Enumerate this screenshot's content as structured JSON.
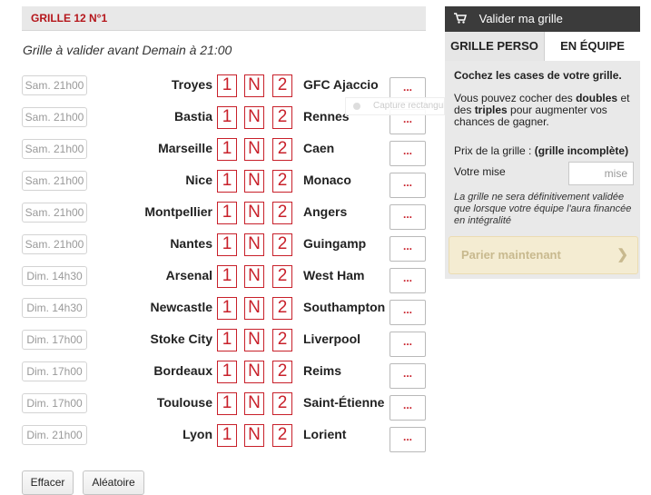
{
  "grid": {
    "title": "GRILLE 12 N°1",
    "deadline": "Grille à valider avant Demain à 21:00",
    "pick_labels": [
      "1",
      "N",
      "2"
    ],
    "more_label": "...",
    "matches": [
      {
        "date": "Sam. 21h00",
        "home": "Troyes",
        "away": "GFC Ajaccio"
      },
      {
        "date": "Sam. 21h00",
        "home": "Bastia",
        "away": "Rennes"
      },
      {
        "date": "Sam. 21h00",
        "home": "Marseille",
        "away": "Caen"
      },
      {
        "date": "Sam. 21h00",
        "home": "Nice",
        "away": "Monaco"
      },
      {
        "date": "Sam. 21h00",
        "home": "Montpellier",
        "away": "Angers"
      },
      {
        "date": "Sam. 21h00",
        "home": "Nantes",
        "away": "Guingamp"
      },
      {
        "date": "Dim. 14h30",
        "home": "Arsenal",
        "away": "West Ham"
      },
      {
        "date": "Dim. 14h30",
        "home": "Newcastle",
        "away": "Southampton"
      },
      {
        "date": "Dim. 17h00",
        "home": "Stoke City",
        "away": "Liverpool"
      },
      {
        "date": "Dim. 17h00",
        "home": "Bordeaux",
        "away": "Reims"
      },
      {
        "date": "Dim. 17h00",
        "home": "Toulouse",
        "away": "Saint-Étienne"
      },
      {
        "date": "Dim. 21h00",
        "home": "Lyon",
        "away": "Lorient"
      }
    ],
    "tooltip_text": "Capture rectangulaire",
    "clear_label": "Effacer",
    "random_label": "Aléatoire"
  },
  "panel": {
    "header": "Valider ma grille",
    "tabs": [
      "GRILLE PERSO",
      "EN ÉQUIPE"
    ],
    "active_tab": "EN ÉQUIPE",
    "instruction": "Cochez les cases de votre grille.",
    "info_1": "Vous pouvez cocher des ",
    "info_doubles": "doubles",
    "info_2": " et des ",
    "info_triples": "triples",
    "info_3": " pour augmenter vos chances de gagner.",
    "price_label": "Prix de la grille :",
    "price_value": "(grille incomplète)",
    "stake_label": "Votre mise",
    "stake_placeholder": "mise",
    "note": "La grille ne sera définitivement validée que lorsque votre équipe l'aura financée en intégralité",
    "bet_label": "Parier maintenant"
  },
  "colors": {
    "accent_red": "#c8202a",
    "header_dark": "#3b3b3b",
    "bet_button_bg": "#f4ecd2"
  }
}
